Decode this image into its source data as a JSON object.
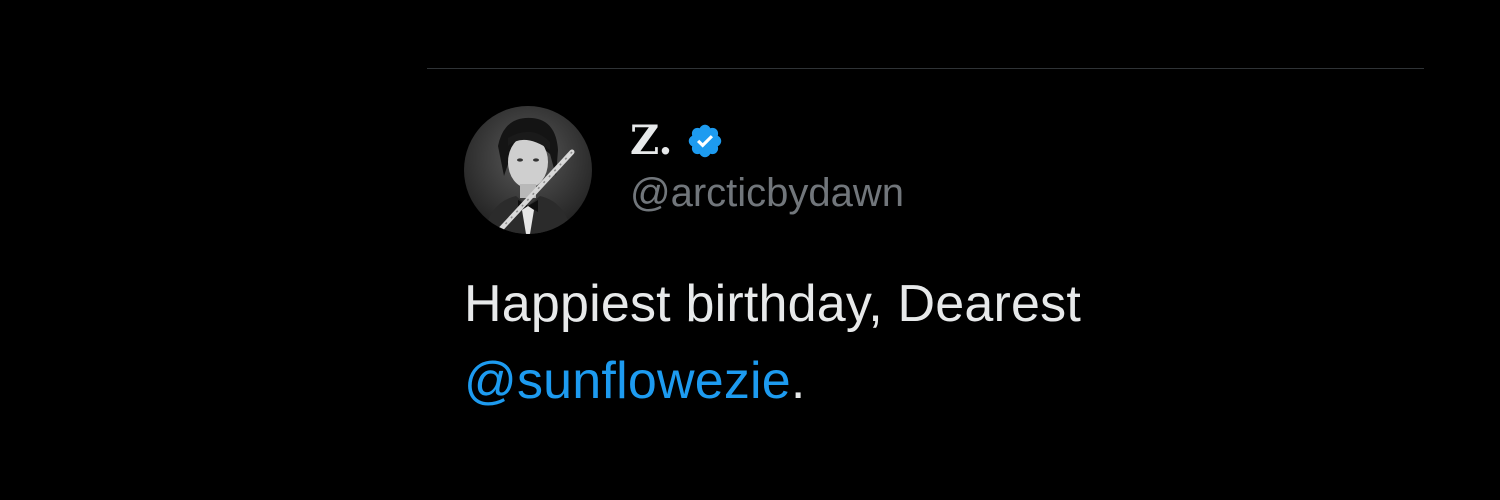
{
  "tweet": {
    "display_name": "Z.",
    "handle": "@arcticbydawn",
    "verified": true,
    "avatar_icon": "profile-photo",
    "text_before": "Happiest birthday, Dearest",
    "mention": "@sunflowezie",
    "text_after": "."
  },
  "colors": {
    "background": "#000000",
    "text_primary": "#e7e9ea",
    "text_secondary": "#71767b",
    "accent": "#1d9bf0",
    "divider": "#2f3336"
  }
}
